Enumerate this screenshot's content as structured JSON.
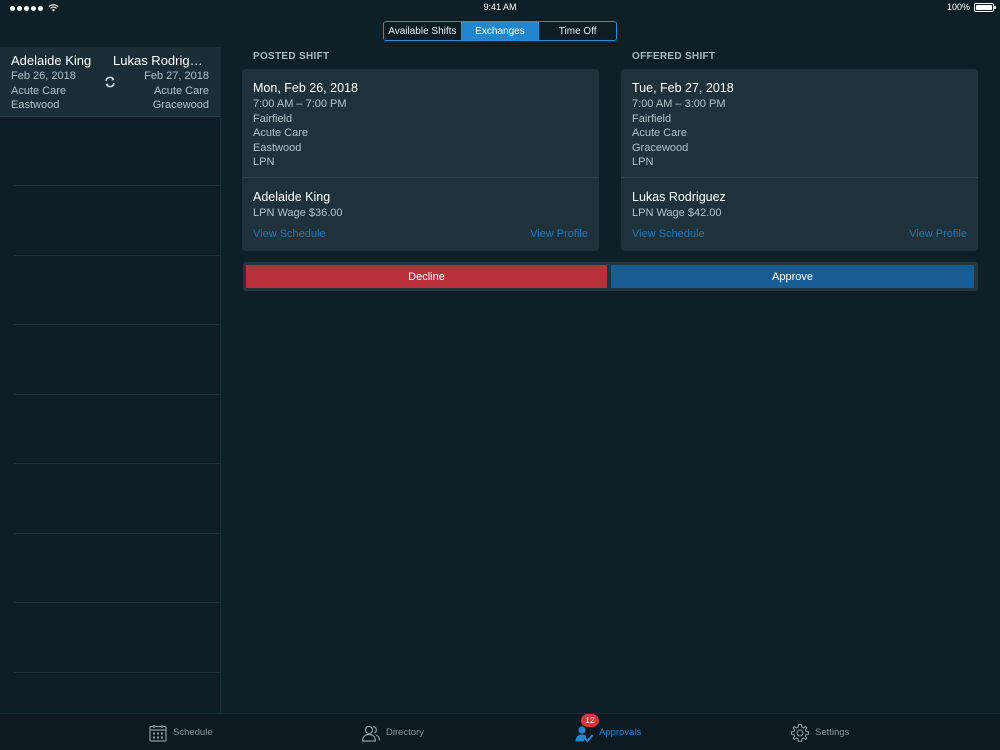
{
  "status_bar": {
    "time": "9:41 AM",
    "battery": "100%",
    "battery_level": 1.0
  },
  "segmented": {
    "tabs": [
      {
        "label": "Available Shifts",
        "active": false
      },
      {
        "label": "Exchanges",
        "active": true
      },
      {
        "label": "Time Off",
        "active": false
      }
    ]
  },
  "sidebar": {
    "exchange": {
      "left": {
        "name": "Adelaide King",
        "date": "Feb 26, 2018",
        "unit": "Acute Care",
        "location": "Eastwood"
      },
      "right": {
        "name": "Lukas Rodriguez",
        "date": "Feb 27, 2018",
        "unit": "Acute Care",
        "location": "Gracewood"
      }
    }
  },
  "posted": {
    "header": "POSTED SHIFT",
    "date": "Mon, Feb 26, 2018",
    "time": "7:00 AM – 7:00 PM",
    "facility": "Fairfield",
    "unit": "Acute Care",
    "location": "Eastwood",
    "role": "LPN",
    "person": "Adelaide King",
    "wage": "LPN Wage $36.00",
    "view_schedule": "View Schedule",
    "view_profile": "View Profile"
  },
  "offered": {
    "header": "OFFERED SHIFT",
    "date": "Tue, Feb 27, 2018",
    "time": "7:00 AM – 3:00 PM",
    "facility": "Fairfield",
    "unit": "Acute Care",
    "location": "Gracewood",
    "role": "LPN",
    "person": "Lukas Rodriguez",
    "wage": "LPN Wage $42.00",
    "view_schedule": "View Schedule",
    "view_profile": "View Profile"
  },
  "actions": {
    "decline": "Decline",
    "approve": "Approve"
  },
  "tabbar": {
    "schedule": "Schedule",
    "directory": "Directory",
    "approvals": "Approvals",
    "approvals_badge": "12",
    "settings": "Settings"
  },
  "colors": {
    "background": "#0f1f27",
    "card": "#1f323b",
    "accent": "#1f86cf",
    "decline": "#b7303a",
    "approve": "#175c92",
    "badge": "#e0323b"
  }
}
